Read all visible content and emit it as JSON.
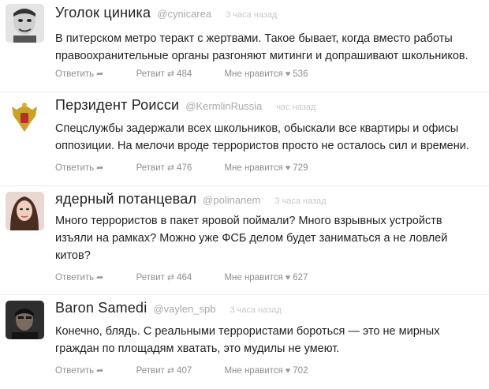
{
  "tweets": [
    {
      "name": "Уголок циника",
      "handle": "@cynicarea",
      "time": "3 часа назад",
      "text": "В питерском метро теракт с жертвами. Такое бывает, когда вместо работы правоохранительные органы разгоняют митинги и допрашивают школьников.",
      "reply_label": "Ответить",
      "retweet_label": "Ретвит",
      "retweets": "484",
      "like_label": "Мне нравится",
      "likes": "536",
      "avatar_colors": [
        "#d9d9d9",
        "#4a4a4a"
      ]
    },
    {
      "name": "Перзидент Роисси",
      "handle": "@KermlinRussia",
      "time": "час назад",
      "text": "Спецслужбы задержали всех школьников, обыскали все квартиры и офисы оппозиции. На мелочи вроде террористов просто не осталось сил и времени.",
      "reply_label": "Ответить",
      "retweet_label": "Ретвит",
      "retweets": "476",
      "like_label": "Мне нравится",
      "likes": "729",
      "avatar_colors": [
        "#ffffff",
        "#c9a227"
      ]
    },
    {
      "name": "ядерный потанцевал",
      "handle": "@polinanem",
      "time": "3 часа назад",
      "text": "Много террористов в пакет яровой поймали? Много взрывных устройств изъяли на рамках? Можно уже ФСБ делом будет заниматься а не ловлей китов?",
      "reply_label": "Ответить",
      "retweet_label": "Ретвит",
      "retweets": "464",
      "like_label": "Мне нравится",
      "likes": "627",
      "avatar_colors": [
        "#e9d8d2",
        "#5a3a2e"
      ]
    },
    {
      "name": "Baron Samedi",
      "handle": "@vaylen_spb",
      "time": "3 часа назад",
      "text": "Конечно, блядь. С реальными террористами бороться — это не мирных граждан по площадям хватать, это мудилы не умеют.",
      "reply_label": "Ответить",
      "retweet_label": "Ретвит",
      "retweets": "407",
      "like_label": "Мне нравится",
      "likes": "702",
      "avatar_colors": [
        "#3a3a3a",
        "#1a1a1a"
      ]
    }
  ],
  "icons": {
    "reply": "reply-arrow-icon",
    "retweet": "retweet-icon",
    "like": "heart-icon"
  }
}
